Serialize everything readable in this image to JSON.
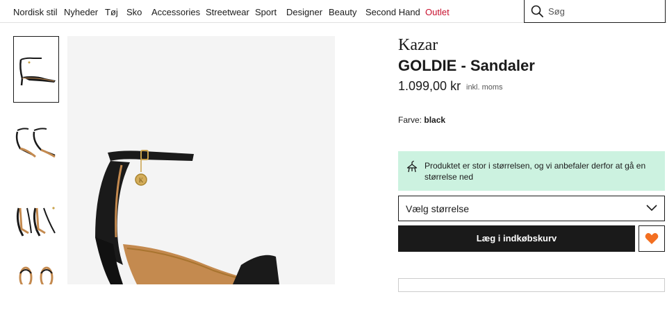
{
  "nav": {
    "items": [
      "Nordisk stil",
      "Nyheder",
      "Tøj",
      "Sko",
      "Accessories",
      "Streetwear",
      "Sport",
      "Designer",
      "Beauty",
      "Second Hand",
      "Outlet"
    ],
    "outlet_color": "#c8102e"
  },
  "search": {
    "placeholder": "Søg",
    "icon": "search-icon"
  },
  "product": {
    "brand": "Kazar",
    "name": "GOLDIE - Sandaler",
    "price": "1.099,00 kr",
    "vat_note": "inkl. moms",
    "color_label": "Farve:",
    "color_value": "black"
  },
  "fit_notice": {
    "icon": "hanger-icon",
    "text": "Produktet er stor i størrelsen, og vi anbefaler derfor at gå en størrelse ned",
    "background": "#ccf2e0"
  },
  "size_select": {
    "label": "Vælg størrelse",
    "icon": "chevron-down-icon"
  },
  "actions": {
    "add_to_cart": "Læg i indkøbskurv",
    "favorite_icon": "heart-icon",
    "favorite_color": "#f36f21"
  },
  "gallery": {
    "thumbnail_count": 4,
    "active_index": 0
  },
  "colors": {
    "text": "#1a1a1a",
    "button_bg": "#1a1a1a",
    "image_bg": "#f4f4f4"
  }
}
